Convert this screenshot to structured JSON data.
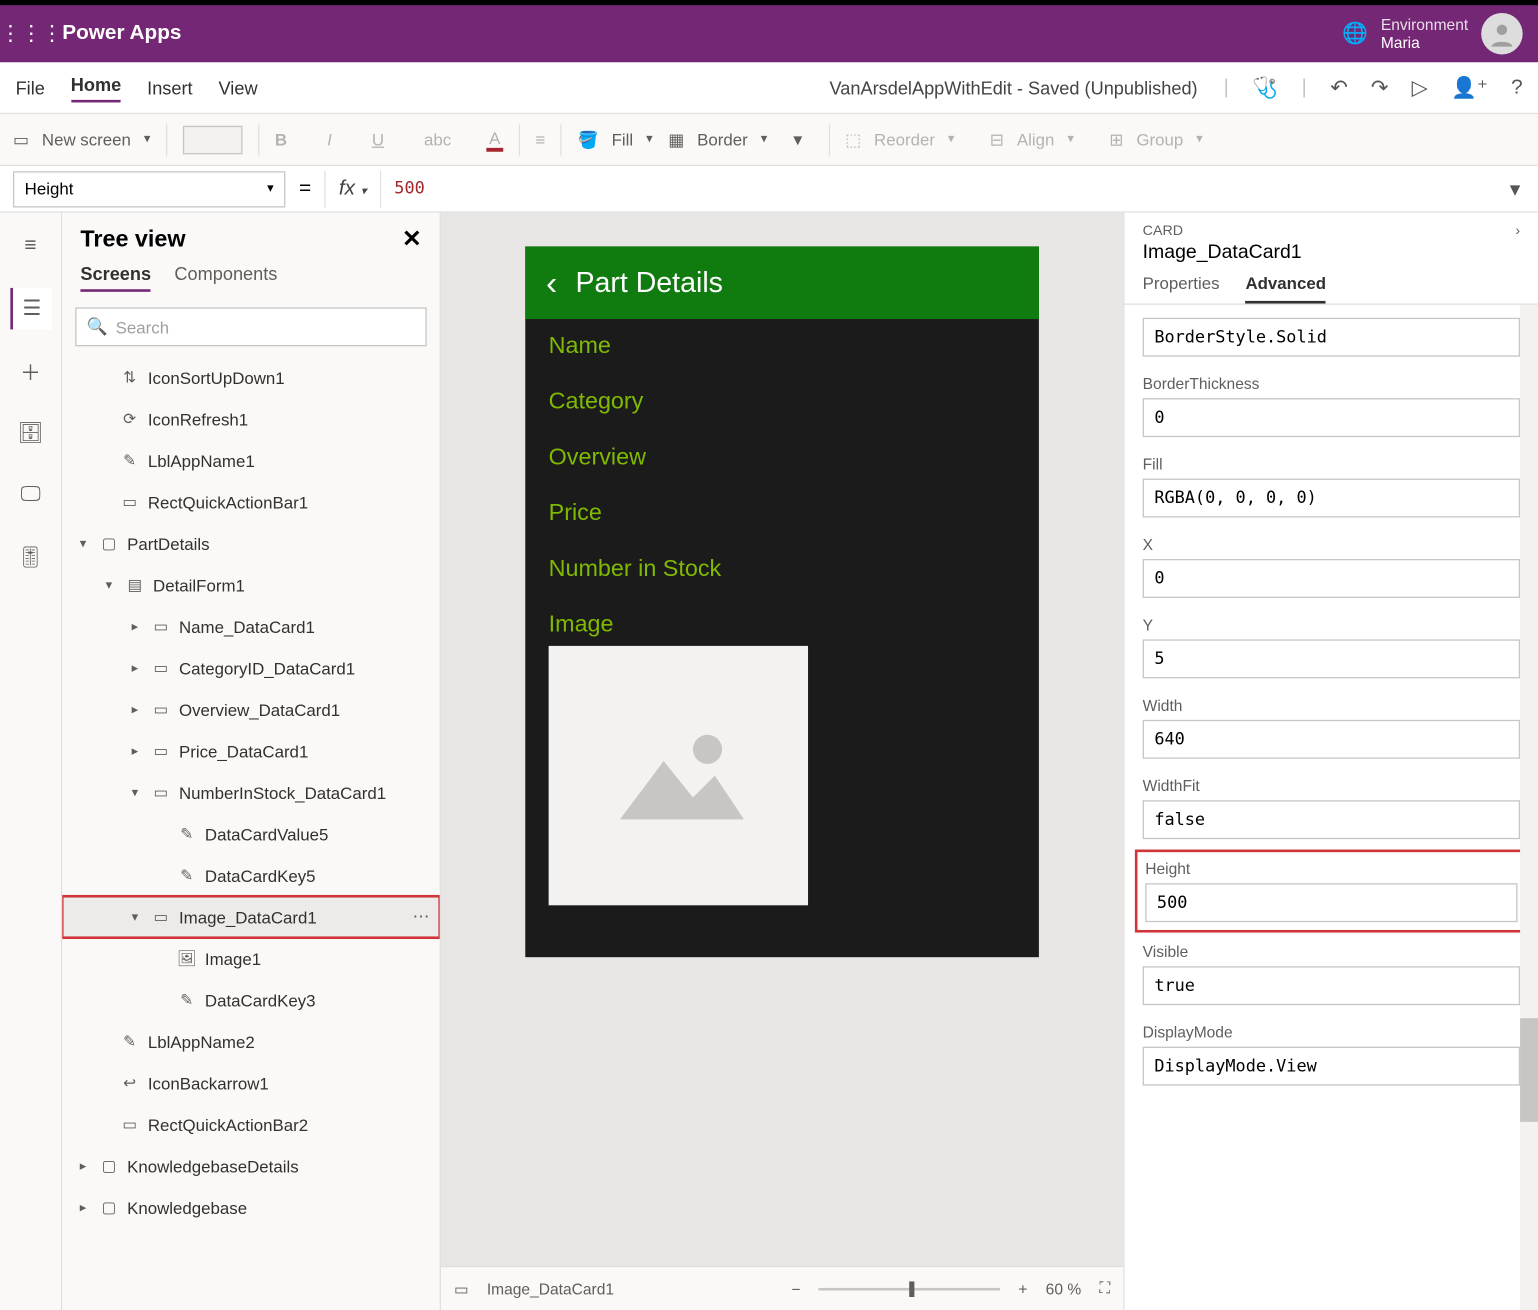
{
  "header": {
    "product": "Power Apps",
    "env_label": "Environment",
    "env_name": "Maria"
  },
  "menu": {
    "file": "File",
    "home": "Home",
    "insert": "Insert",
    "view": "View",
    "doc_status": "VanArsdelAppWithEdit - Saved (Unpublished)"
  },
  "cmd": {
    "new_screen": "New screen",
    "fill": "Fill",
    "border": "Border",
    "reorder": "Reorder",
    "align": "Align",
    "group": "Group"
  },
  "formula": {
    "property": "Height",
    "fx": "fx",
    "value": "500"
  },
  "tree": {
    "title": "Tree view",
    "tab_screens": "Screens",
    "tab_components": "Components",
    "search_ph": "Search",
    "nodes": {
      "n1": "IconSortUpDown1",
      "n2": "IconRefresh1",
      "n3": "LblAppName1",
      "n4": "RectQuickActionBar1",
      "n5": "PartDetails",
      "n6": "DetailForm1",
      "n7": "Name_DataCard1",
      "n8": "CategoryID_DataCard1",
      "n9": "Overview_DataCard1",
      "n10": "Price_DataCard1",
      "n11": "NumberInStock_DataCard1",
      "n12": "DataCardValue5",
      "n13": "DataCardKey5",
      "n14": "Image_DataCard1",
      "n15": "Image1",
      "n16": "DataCardKey3",
      "n17": "LblAppName2",
      "n18": "IconBackarrow1",
      "n19": "RectQuickActionBar2",
      "n20": "KnowledgebaseDetails",
      "n21": "Knowledgebase"
    }
  },
  "canvas": {
    "title": "Part Details",
    "fields": {
      "f1": "Name",
      "f2": "Category",
      "f3": "Overview",
      "f4": "Price",
      "f5": "Number in Stock",
      "f6": "Image"
    },
    "footer_sel": "Image_DataCard1",
    "zoom": "60  %"
  },
  "props": {
    "type": "CARD",
    "name": "Image_DataCard1",
    "tab_props": "Properties",
    "tab_adv": "Advanced",
    "items": {
      "borderstyle_v": "BorderStyle.Solid",
      "borderthickness_l": "BorderThickness",
      "borderthickness_v": "0",
      "fill_l": "Fill",
      "fill_v": "RGBA(0, 0, 0, 0)",
      "x_l": "X",
      "x_v": "0",
      "y_l": "Y",
      "y_v": "5",
      "width_l": "Width",
      "width_v": "640",
      "widthfit_l": "WidthFit",
      "widthfit_v": "false",
      "height_l": "Height",
      "height_v": "500",
      "visible_l": "Visible",
      "visible_v": "true",
      "displaymode_l": "DisplayMode",
      "displaymode_v": "DisplayMode.View"
    }
  }
}
